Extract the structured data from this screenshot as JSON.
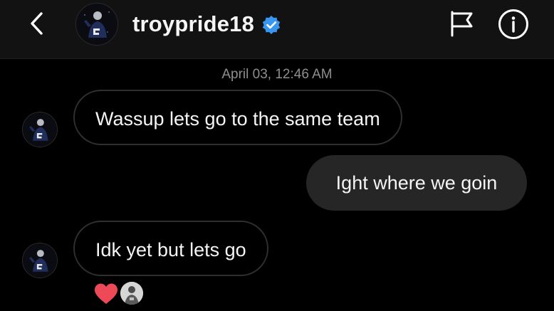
{
  "header": {
    "username": "troypride18",
    "icons": {
      "back": "chevron-left-icon",
      "verified": "verified-badge-icon",
      "flag": "flag-icon",
      "info": "info-icon"
    },
    "verified_color": "#3897f0"
  },
  "thread": {
    "timestamp": "April 03, 12:46 AM",
    "messages": [
      {
        "sender": "them",
        "text": "Wassup lets go to the same team"
      },
      {
        "sender": "me",
        "text": "Ight where we goin"
      },
      {
        "sender": "them",
        "text": "Idk yet but lets go"
      }
    ],
    "reaction": {
      "icon": "heart-icon",
      "color": "#ed4956"
    }
  },
  "colors": {
    "background": "#000000",
    "header_background": "#121212",
    "outgoing_bubble": "#262626",
    "incoming_border": "#2f2f2f",
    "timestamp": "#8e8e8e"
  }
}
